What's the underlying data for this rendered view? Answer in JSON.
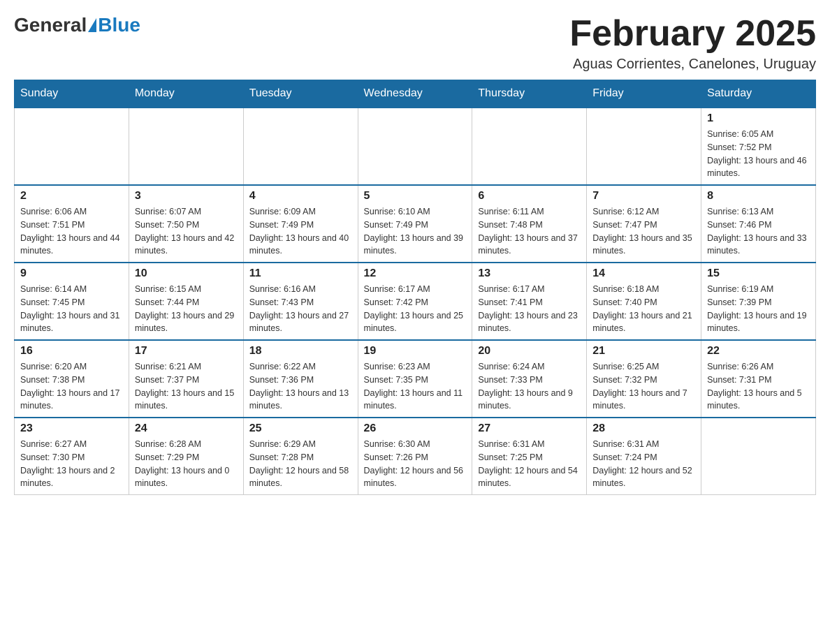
{
  "header": {
    "logo_general": "General",
    "logo_blue": "Blue",
    "month_title": "February 2025",
    "location": "Aguas Corrientes, Canelones, Uruguay"
  },
  "weekdays": [
    "Sunday",
    "Monday",
    "Tuesday",
    "Wednesday",
    "Thursday",
    "Friday",
    "Saturday"
  ],
  "weeks": [
    [
      {
        "day": "",
        "info": ""
      },
      {
        "day": "",
        "info": ""
      },
      {
        "day": "",
        "info": ""
      },
      {
        "day": "",
        "info": ""
      },
      {
        "day": "",
        "info": ""
      },
      {
        "day": "",
        "info": ""
      },
      {
        "day": "1",
        "info": "Sunrise: 6:05 AM\nSunset: 7:52 PM\nDaylight: 13 hours and 46 minutes."
      }
    ],
    [
      {
        "day": "2",
        "info": "Sunrise: 6:06 AM\nSunset: 7:51 PM\nDaylight: 13 hours and 44 minutes."
      },
      {
        "day": "3",
        "info": "Sunrise: 6:07 AM\nSunset: 7:50 PM\nDaylight: 13 hours and 42 minutes."
      },
      {
        "day": "4",
        "info": "Sunrise: 6:09 AM\nSunset: 7:49 PM\nDaylight: 13 hours and 40 minutes."
      },
      {
        "day": "5",
        "info": "Sunrise: 6:10 AM\nSunset: 7:49 PM\nDaylight: 13 hours and 39 minutes."
      },
      {
        "day": "6",
        "info": "Sunrise: 6:11 AM\nSunset: 7:48 PM\nDaylight: 13 hours and 37 minutes."
      },
      {
        "day": "7",
        "info": "Sunrise: 6:12 AM\nSunset: 7:47 PM\nDaylight: 13 hours and 35 minutes."
      },
      {
        "day": "8",
        "info": "Sunrise: 6:13 AM\nSunset: 7:46 PM\nDaylight: 13 hours and 33 minutes."
      }
    ],
    [
      {
        "day": "9",
        "info": "Sunrise: 6:14 AM\nSunset: 7:45 PM\nDaylight: 13 hours and 31 minutes."
      },
      {
        "day": "10",
        "info": "Sunrise: 6:15 AM\nSunset: 7:44 PM\nDaylight: 13 hours and 29 minutes."
      },
      {
        "day": "11",
        "info": "Sunrise: 6:16 AM\nSunset: 7:43 PM\nDaylight: 13 hours and 27 minutes."
      },
      {
        "day": "12",
        "info": "Sunrise: 6:17 AM\nSunset: 7:42 PM\nDaylight: 13 hours and 25 minutes."
      },
      {
        "day": "13",
        "info": "Sunrise: 6:17 AM\nSunset: 7:41 PM\nDaylight: 13 hours and 23 minutes."
      },
      {
        "day": "14",
        "info": "Sunrise: 6:18 AM\nSunset: 7:40 PM\nDaylight: 13 hours and 21 minutes."
      },
      {
        "day": "15",
        "info": "Sunrise: 6:19 AM\nSunset: 7:39 PM\nDaylight: 13 hours and 19 minutes."
      }
    ],
    [
      {
        "day": "16",
        "info": "Sunrise: 6:20 AM\nSunset: 7:38 PM\nDaylight: 13 hours and 17 minutes."
      },
      {
        "day": "17",
        "info": "Sunrise: 6:21 AM\nSunset: 7:37 PM\nDaylight: 13 hours and 15 minutes."
      },
      {
        "day": "18",
        "info": "Sunrise: 6:22 AM\nSunset: 7:36 PM\nDaylight: 13 hours and 13 minutes."
      },
      {
        "day": "19",
        "info": "Sunrise: 6:23 AM\nSunset: 7:35 PM\nDaylight: 13 hours and 11 minutes."
      },
      {
        "day": "20",
        "info": "Sunrise: 6:24 AM\nSunset: 7:33 PM\nDaylight: 13 hours and 9 minutes."
      },
      {
        "day": "21",
        "info": "Sunrise: 6:25 AM\nSunset: 7:32 PM\nDaylight: 13 hours and 7 minutes."
      },
      {
        "day": "22",
        "info": "Sunrise: 6:26 AM\nSunset: 7:31 PM\nDaylight: 13 hours and 5 minutes."
      }
    ],
    [
      {
        "day": "23",
        "info": "Sunrise: 6:27 AM\nSunset: 7:30 PM\nDaylight: 13 hours and 2 minutes."
      },
      {
        "day": "24",
        "info": "Sunrise: 6:28 AM\nSunset: 7:29 PM\nDaylight: 13 hours and 0 minutes."
      },
      {
        "day": "25",
        "info": "Sunrise: 6:29 AM\nSunset: 7:28 PM\nDaylight: 12 hours and 58 minutes."
      },
      {
        "day": "26",
        "info": "Sunrise: 6:30 AM\nSunset: 7:26 PM\nDaylight: 12 hours and 56 minutes."
      },
      {
        "day": "27",
        "info": "Sunrise: 6:31 AM\nSunset: 7:25 PM\nDaylight: 12 hours and 54 minutes."
      },
      {
        "day": "28",
        "info": "Sunrise: 6:31 AM\nSunset: 7:24 PM\nDaylight: 12 hours and 52 minutes."
      },
      {
        "day": "",
        "info": ""
      }
    ]
  ]
}
